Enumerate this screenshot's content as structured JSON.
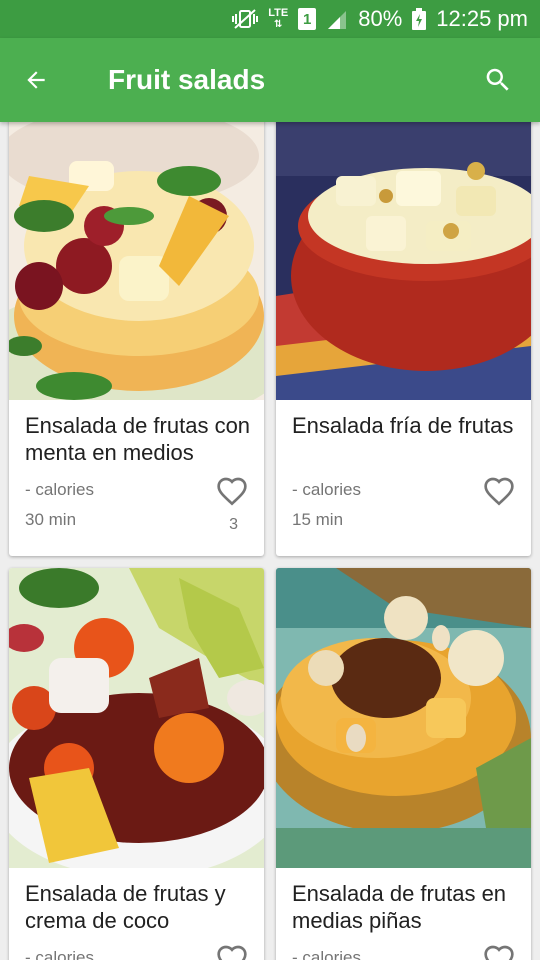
{
  "status_bar": {
    "network": "LTE",
    "sim": "1",
    "battery": "80%",
    "time": "12:25 pm"
  },
  "toolbar": {
    "title": "Fruit salads"
  },
  "recipes": [
    {
      "name": "Ensalada de frutas con menta en medios",
      "calories": "- calories",
      "time": "30 min",
      "likes": "3"
    },
    {
      "name": "Ensalada fría de frutas",
      "calories": "- calories",
      "time": "15 min",
      "likes": ""
    },
    {
      "name": "Ensalada de frutas y crema de coco",
      "calories": "- calories",
      "time": "",
      "likes": ""
    },
    {
      "name": "Ensalada de frutas en medias piñas",
      "calories": "- calories",
      "time": "",
      "likes": ""
    }
  ],
  "colors": {
    "primary": "#4caf50",
    "status_bar": "#3d9c42"
  }
}
